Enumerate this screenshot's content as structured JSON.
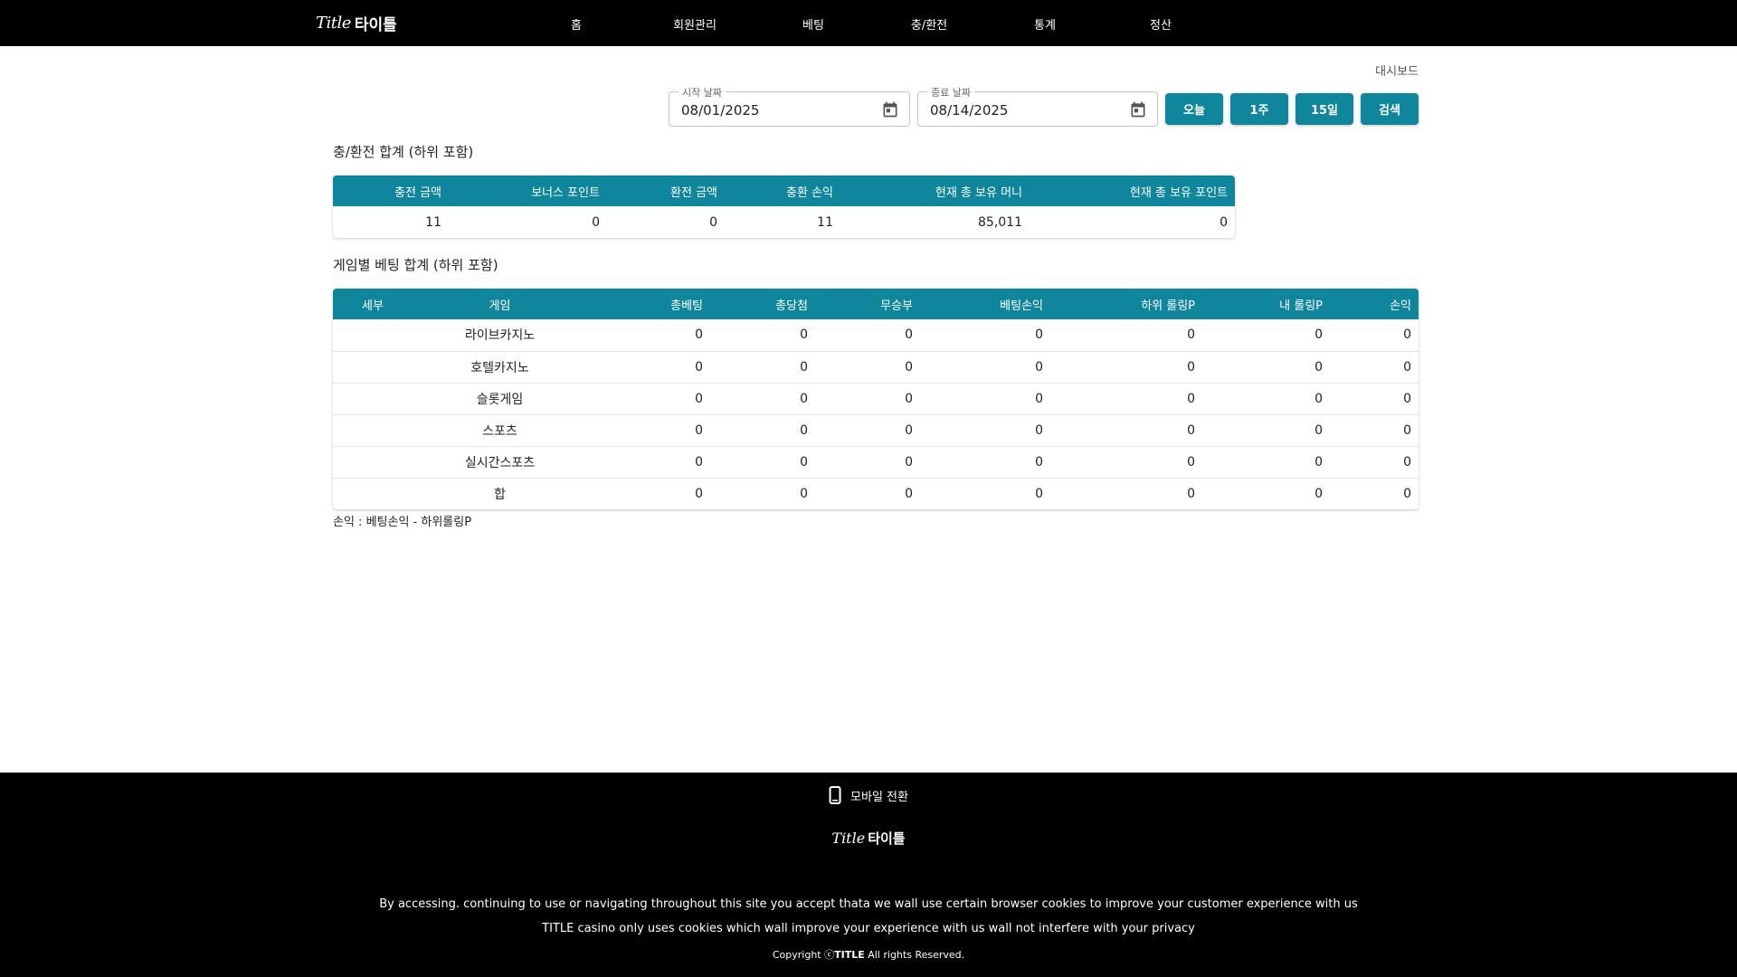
{
  "header": {
    "logo_script": "Title",
    "logo_korean": "타이틀",
    "nav": [
      "홈",
      "회원관리",
      "베팅",
      "충/환전",
      "통계",
      "정산"
    ]
  },
  "breadcrumb": "대시보드",
  "filters": {
    "start_label": "시작 날짜",
    "start_value": "08/01/2025",
    "end_label": "종료 날짜",
    "end_value": "08/14/2025",
    "buttons": [
      "오늘",
      "1주",
      "15일",
      "검색"
    ]
  },
  "exchange_summary": {
    "title": "충/환전 합계 (하위 포함)",
    "headers": [
      "충전 금액",
      "보너스 포인트",
      "환전 금액",
      "충환 손익",
      "현재 총 보유 머니",
      "현재 총 보유 포인트"
    ],
    "values": [
      "11",
      "0",
      "0",
      "11",
      "85,011",
      "0"
    ]
  },
  "game_summary": {
    "title": "게임별 베팅 합계 (하위 포함)",
    "headers": [
      "세부",
      "게임",
      "총베팅",
      "총당첨",
      "무승부",
      "베팅손익",
      "하위 롤링P",
      "내 롤링P",
      "손익"
    ],
    "rows": [
      [
        "",
        "라이브카지노",
        "0",
        "0",
        "0",
        "0",
        "0",
        "0",
        "0"
      ],
      [
        "",
        "호텔카지노",
        "0",
        "0",
        "0",
        "0",
        "0",
        "0",
        "0"
      ],
      [
        "",
        "슬롯게임",
        "0",
        "0",
        "0",
        "0",
        "0",
        "0",
        "0"
      ],
      [
        "",
        "스포츠",
        "0",
        "0",
        "0",
        "0",
        "0",
        "0",
        "0"
      ],
      [
        "",
        "실시간스포츠",
        "0",
        "0",
        "0",
        "0",
        "0",
        "0",
        "0"
      ],
      [
        "",
        "합",
        "0",
        "0",
        "0",
        "0",
        "0",
        "0",
        "0"
      ]
    ],
    "note": "손익 : 베팅손익 - 하위롤링P"
  },
  "footer": {
    "mobile_switch": "모바일 전환",
    "logo_script": "Title",
    "logo_korean": "타이틀",
    "line1": "By accessing. continuing to use or navigating throughout this site you accept thata we wall use certain browser cookies to improve your customer experience with us",
    "line2": "TITLE casino only uses cookies which wall improve your experience with us wall not interfere with your privacy",
    "copyright_prefix": "Copyright ⓒ",
    "copyright_brand": "TITLE",
    "copyright_suffix": " All rights Reserved."
  },
  "colors": {
    "accent": "#0f869c",
    "header_bg": "#000000",
    "footer_bg": "#000000"
  },
  "icons": [
    "calendar-icon",
    "mobile-phone-icon"
  ]
}
